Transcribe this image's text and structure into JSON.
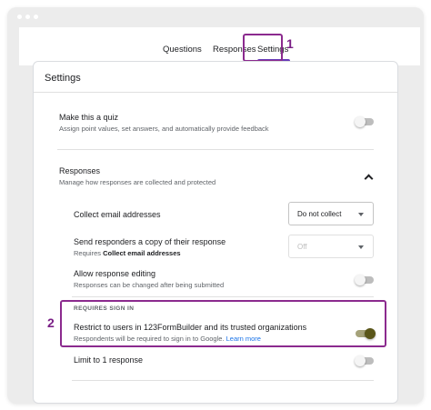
{
  "tabs": [
    {
      "label": "Questions"
    },
    {
      "label": "Responses"
    },
    {
      "label": "Settings"
    }
  ],
  "markers": [
    "1",
    "2"
  ],
  "settings": {
    "title": "Settings",
    "quiz": {
      "title": "Make this a quiz",
      "subtitle": "Assign point values, set answers, and automatically provide feedback",
      "enabled": false
    },
    "responses": {
      "title": "Responses",
      "subtitle": "Manage how responses are collected and protected",
      "collect_email": {
        "title": "Collect email addresses",
        "value": "Do not collect"
      },
      "send_copy": {
        "title": "Send responders a copy of their response",
        "subtitle_prefix": "Requires ",
        "subtitle_bold": "Collect email addresses",
        "value": "Off"
      },
      "allow_editing": {
        "title": "Allow response editing",
        "subtitle": "Responses can be changed after being submitted",
        "enabled": false
      },
      "requires_sign_in_label": "REQUIRES SIGN IN",
      "restrict": {
        "title": "Restrict to users in 123FormBuilder and its trusted organizations",
        "subtitle": "Respondents will be required to sign in to Google.",
        "learn_more": "Learn more",
        "enabled": true
      },
      "limit": {
        "title": "Limit to 1 response",
        "enabled": false
      }
    }
  },
  "colors": {
    "accent": "#673ab7",
    "highlight": "#8b2a8e",
    "link": "#1a73e8",
    "toggle_on": "#5a5619"
  }
}
